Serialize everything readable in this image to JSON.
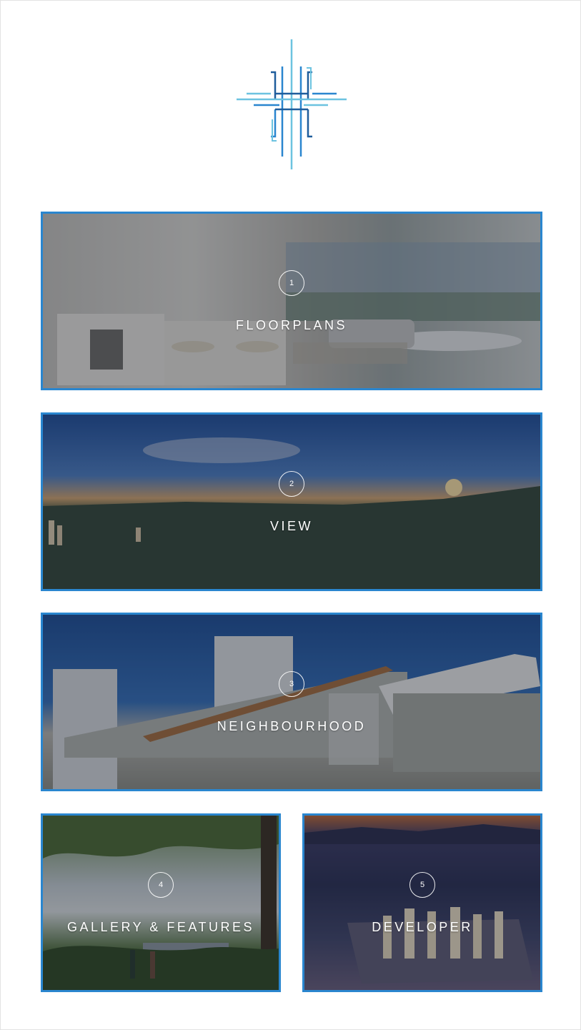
{
  "logo": {
    "icon": "h-monogram-logo",
    "colors": [
      "#1f5d9c",
      "#2a86cf",
      "#6cc3e0"
    ]
  },
  "tiles": [
    {
      "number": "1",
      "label": "FLOORPLANS"
    },
    {
      "number": "2",
      "label": "VIEW"
    },
    {
      "number": "3",
      "label": "NEIGHBOURHOOD"
    },
    {
      "number": "4",
      "label": "GALLERY & FEATURES"
    },
    {
      "number": "5",
      "label": "DEVELOPER"
    }
  ],
  "colors": {
    "tile_border": "#2a86cf",
    "text": "#ffffff"
  }
}
